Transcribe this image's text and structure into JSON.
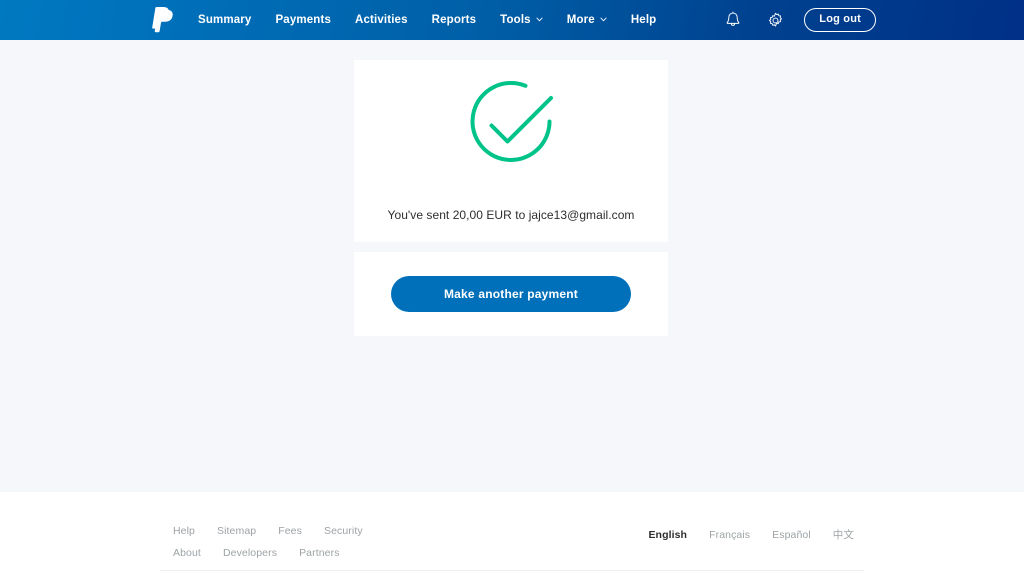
{
  "navbar": {
    "logo_name": "paypal-logo",
    "links": [
      {
        "label": "Summary",
        "has_caret": false
      },
      {
        "label": "Payments",
        "has_caret": false
      },
      {
        "label": "Activities",
        "has_caret": false
      },
      {
        "label": "Reports",
        "has_caret": false
      },
      {
        "label": "Tools",
        "has_caret": true
      },
      {
        "label": "More",
        "has_caret": true
      },
      {
        "label": "Help",
        "has_caret": false
      }
    ],
    "notifications_icon": "bell-icon",
    "settings_icon": "gear-icon",
    "logout_label": "Log out",
    "gradient_start": "#0079c1",
    "gradient_end": "#003087"
  },
  "status_card": {
    "icon": "check-circle-icon",
    "icon_color": "#00c389",
    "message": "You've sent 20,00 EUR to jajce13@gmail.com",
    "amount": "20,00",
    "currency": "EUR",
    "recipient": "jajce13@gmail.com"
  },
  "action_card": {
    "button_label": "Make another payment",
    "button_color": "#0070ba"
  },
  "footer": {
    "rows": [
      [
        {
          "label": "Help"
        },
        {
          "label": "Sitemap"
        },
        {
          "label": "Fees"
        },
        {
          "label": "Security"
        }
      ],
      [
        {
          "label": "About"
        },
        {
          "label": "Developers"
        },
        {
          "label": "Partners"
        }
      ]
    ],
    "languages": [
      {
        "label": "English",
        "active": true
      },
      {
        "label": "Français",
        "active": false
      },
      {
        "label": "Español",
        "active": false
      },
      {
        "label": "中文",
        "active": false
      }
    ]
  },
  "theme": {
    "page_background": "#f5f7fa",
    "card_background": "#ffffff",
    "text_color": "#2c2e2f",
    "muted_text_color": "#9da3a6"
  }
}
